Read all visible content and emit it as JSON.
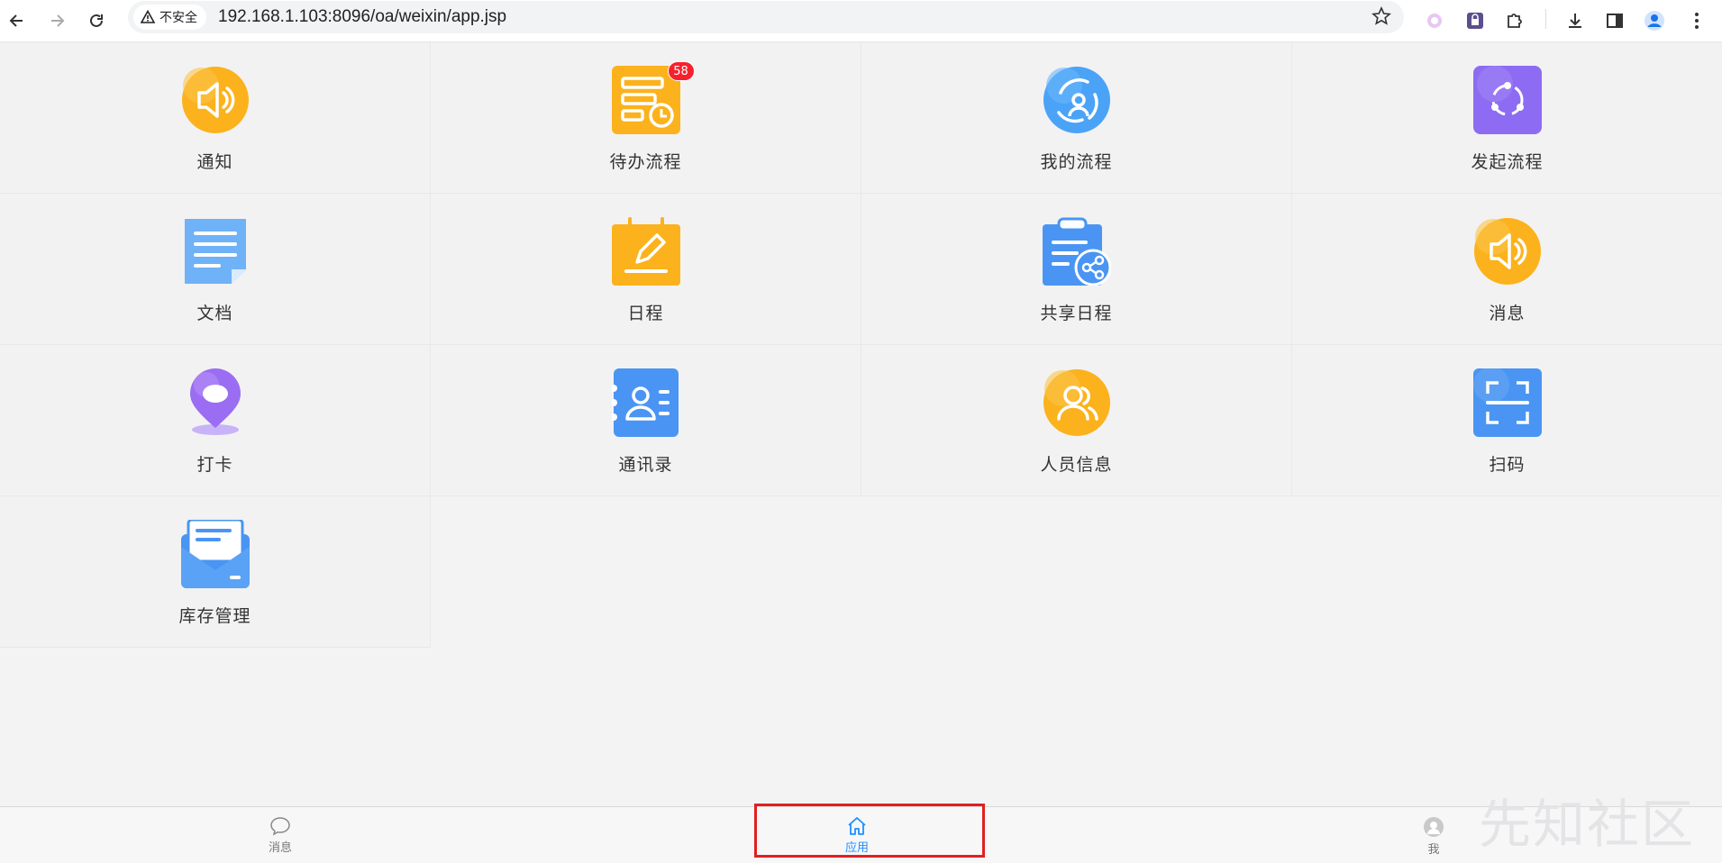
{
  "browser": {
    "security_label": "不安全",
    "url": "192.168.1.103:8096/oa/weixin/app.jsp"
  },
  "apps": [
    {
      "label": "通知",
      "icon": "speaker-icon",
      "color": "#fbb21c"
    },
    {
      "label": "待办流程",
      "icon": "todo-flow-icon",
      "color": "#fbb21c",
      "badge": "58"
    },
    {
      "label": "我的流程",
      "icon": "my-flow-icon",
      "color": "#4aa3f7"
    },
    {
      "label": "发起流程",
      "icon": "start-flow-icon",
      "color": "#8d6cf3"
    },
    {
      "label": "文档",
      "icon": "document-icon",
      "color": "#6fb2f7"
    },
    {
      "label": "日程",
      "icon": "schedule-icon",
      "color": "#fbb21c"
    },
    {
      "label": "共享日程",
      "icon": "shared-schedule-icon",
      "color": "#4a95f3"
    },
    {
      "label": "消息",
      "icon": "message-speaker-icon",
      "color": "#fbb21c"
    },
    {
      "label": "打卡",
      "icon": "check-in-location-icon",
      "color": "#9a6df2"
    },
    {
      "label": "通讯录",
      "icon": "contacts-icon",
      "color": "#4a95f3"
    },
    {
      "label": "人员信息",
      "icon": "people-info-icon",
      "color": "#fbb21c"
    },
    {
      "label": "扫码",
      "icon": "scan-code-icon",
      "color": "#4a95f3"
    },
    {
      "label": "库存管理",
      "icon": "inventory-icon",
      "color": "#4a95f3"
    }
  ],
  "tabbar": {
    "messages": "消息",
    "apps": "应用",
    "me": "我",
    "active_color": "#1e90ff"
  },
  "watermark": "先知社区"
}
